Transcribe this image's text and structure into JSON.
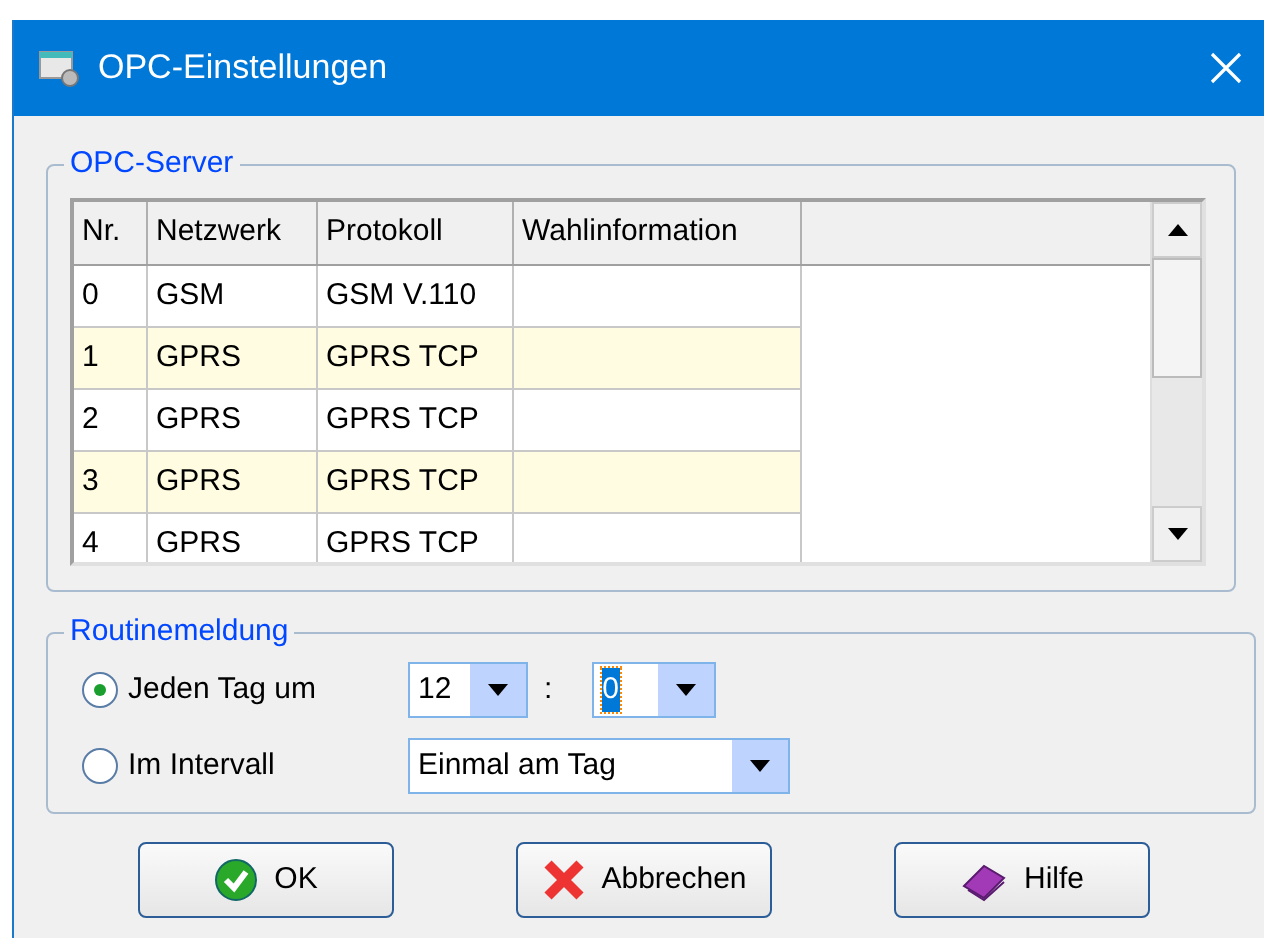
{
  "window": {
    "title": "OPC-Einstellungen"
  },
  "opc_server": {
    "title": "OPC-Server",
    "columns": [
      "Nr.",
      "Netzwerk",
      "Protokoll",
      "Wahlinformation"
    ],
    "rows": [
      {
        "cells": [
          "0",
          "GSM",
          "GSM V.110"
        ]
      },
      {
        "cells": [
          "1",
          "GPRS",
          "GPRS TCP"
        ]
      },
      {
        "cells": [
          "2",
          "GPRS",
          "GPRS TCP"
        ]
      },
      {
        "cells": [
          "3",
          "GPRS",
          "GPRS TCP"
        ]
      },
      {
        "cells": [
          "4",
          "GPRS",
          "GPRS TCP"
        ]
      }
    ]
  },
  "routinemeldung": {
    "title": "Routinemeldung",
    "options": [
      {
        "kind": "time",
        "label": "Jeden Tag um",
        "selected": true,
        "hour": "12",
        "separator": ":",
        "minute": "0"
      },
      {
        "kind": "interval",
        "label": "Im Intervall",
        "selected": false,
        "value": "Einmal am Tag"
      }
    ]
  },
  "buttons": [
    {
      "kind": "ok",
      "label": "OK"
    },
    {
      "kind": "cancel",
      "label": "Abbrechen"
    },
    {
      "kind": "help",
      "label": "Hilfe"
    }
  ]
}
